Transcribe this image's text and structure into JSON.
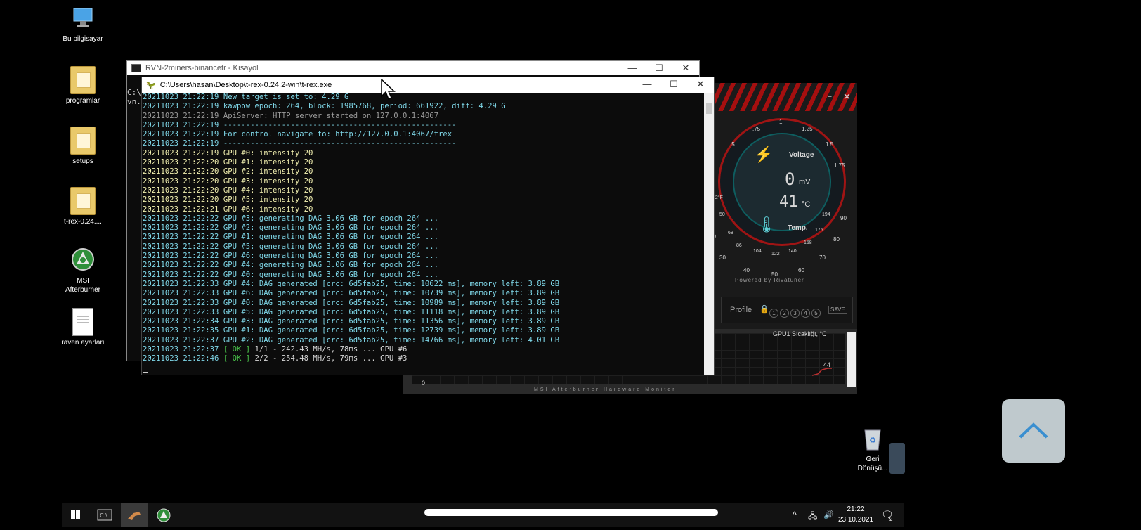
{
  "desktop": {
    "icons": [
      {
        "label": "Bu bilgisayar",
        "icon": "computer-icon"
      },
      {
        "label": "programlar",
        "icon": "folder-icon"
      },
      {
        "label": "setups",
        "icon": "folder-icon"
      },
      {
        "label": "t-rex-0.24....",
        "icon": "folder-icon"
      },
      {
        "label": "MSI Afterburner",
        "icon": "afterburner-icon"
      },
      {
        "label": "raven ayarları",
        "icon": "document-icon"
      }
    ],
    "recycle_bin": "Geri Dönüşü..."
  },
  "back_window": {
    "title": "RVN-2miners-binancetr - Kısayol",
    "visible_text": [
      "C:\\",
      "vn."
    ]
  },
  "terminal": {
    "title": "C:\\Users\\hasan\\Desktop\\t-rex-0.24.2-win\\t-rex.exe",
    "lines": [
      {
        "ts": "20211023 21:22:19",
        "msg": "New target is set to: 4.29 G",
        "color": "cyan"
      },
      {
        "ts": "20211023 21:22:19",
        "msg": "kawpow epoch: 264, block: 1985768, period: 661922, diff: 4.29 G",
        "color": "cyan"
      },
      {
        "ts": "20211023 21:22:19",
        "msg": "ApiServer: HTTP server started on 127.0.0.1:4067",
        "color": "gray"
      },
      {
        "ts": "20211023 21:22:19",
        "msg": "----------------------------------------------------",
        "color": "cyan"
      },
      {
        "ts": "20211023 21:22:19",
        "msg": "For control navigate to: http://127.0.0.1:4067/trex",
        "color": "cyan"
      },
      {
        "ts": "20211023 21:22:19",
        "msg": "----------------------------------------------------",
        "color": "cyan"
      },
      {
        "ts": "20211023 21:22:19",
        "msg": "GPU #0: intensity 20",
        "color": "yellow"
      },
      {
        "ts": "20211023 21:22:20",
        "msg": "GPU #1: intensity 20",
        "color": "yellow"
      },
      {
        "ts": "20211023 21:22:20",
        "msg": "GPU #2: intensity 20",
        "color": "yellow"
      },
      {
        "ts": "20211023 21:22:20",
        "msg": "GPU #3: intensity 20",
        "color": "yellow"
      },
      {
        "ts": "20211023 21:22:20",
        "msg": "GPU #4: intensity 20",
        "color": "yellow"
      },
      {
        "ts": "20211023 21:22:20",
        "msg": "GPU #5: intensity 20",
        "color": "yellow"
      },
      {
        "ts": "20211023 21:22:21",
        "msg": "GPU #6: intensity 20",
        "color": "yellow"
      },
      {
        "ts": "20211023 21:22:22",
        "msg": "GPU #3: generating DAG 3.06 GB for epoch 264 ...",
        "color": "cyan"
      },
      {
        "ts": "20211023 21:22:22",
        "msg": "GPU #2: generating DAG 3.06 GB for epoch 264 ...",
        "color": "cyan"
      },
      {
        "ts": "20211023 21:22:22",
        "msg": "GPU #1: generating DAG 3.06 GB for epoch 264 ...",
        "color": "cyan"
      },
      {
        "ts": "20211023 21:22:22",
        "msg": "GPU #5: generating DAG 3.06 GB for epoch 264 ...",
        "color": "cyan"
      },
      {
        "ts": "20211023 21:22:22",
        "msg": "GPU #6: generating DAG 3.06 GB for epoch 264 ...",
        "color": "cyan"
      },
      {
        "ts": "20211023 21:22:22",
        "msg": "GPU #4: generating DAG 3.06 GB for epoch 264 ...",
        "color": "cyan"
      },
      {
        "ts": "20211023 21:22:22",
        "msg": "GPU #0: generating DAG 3.06 GB for epoch 264 ...",
        "color": "cyan"
      },
      {
        "ts": "20211023 21:22:33",
        "msg": "GPU #4: DAG generated [crc: 6d5fab25, time: 10622 ms], memory left: 3.89 GB",
        "color": "cyan"
      },
      {
        "ts": "20211023 21:22:33",
        "msg": "GPU #6: DAG generated [crc: 6d5fab25, time: 10739 ms], memory left: 3.89 GB",
        "color": "cyan"
      },
      {
        "ts": "20211023 21:22:33",
        "msg": "GPU #0: DAG generated [crc: 6d5fab25, time: 10989 ms], memory left: 3.89 GB",
        "color": "cyan"
      },
      {
        "ts": "20211023 21:22:33",
        "msg": "GPU #5: DAG generated [crc: 6d5fab25, time: 11118 ms], memory left: 3.89 GB",
        "color": "cyan"
      },
      {
        "ts": "20211023 21:22:34",
        "msg": "GPU #3: DAG generated [crc: 6d5fab25, time: 11356 ms], memory left: 3.89 GB",
        "color": "cyan"
      },
      {
        "ts": "20211023 21:22:35",
        "msg": "GPU #1: DAG generated [crc: 6d5fab25, time: 12739 ms], memory left: 3.89 GB",
        "color": "cyan"
      },
      {
        "ts": "20211023 21:22:37",
        "msg": "GPU #2: DAG generated [crc: 6d5fab25, time: 14766 ms], memory left: 4.01 GB",
        "color": "cyan"
      }
    ],
    "share_lines": [
      {
        "ts": "20211023 21:22:37",
        "ok": "[ OK ]",
        "msg": "1/1 - 242.43 MH/s, 78ms ... GPU #6"
      },
      {
        "ts": "20211023 21:22:46",
        "ok": "[ OK ]",
        "msg": "2/2 - 254.48 MH/s, 79ms ... GPU #3"
      }
    ]
  },
  "afterburner": {
    "voltage_label": "Voltage",
    "voltage_value": "0",
    "voltage_unit": "mV",
    "temp_value": "41",
    "temp_unit": "°C",
    "temp_label": "Temp.",
    "powered_by": "Powered by Rivatuner",
    "profile_label": "Profile",
    "profile_slots": [
      "1",
      "2",
      "3",
      "4",
      "5"
    ],
    "save_label": "SAVE",
    "voltage_ticks": [
      ".75",
      "1",
      "1.25",
      ".5",
      "1.5",
      "1.75"
    ],
    "temp_ticks": [
      "32°F",
      "50",
      "68",
      "86",
      "104",
      "122",
      "140",
      "158",
      "176",
      "194"
    ],
    "temp_c_ticks": [
      "20",
      "30",
      "40",
      "50",
      "60",
      "70",
      "80",
      "90"
    ],
    "monitor_title": "GPU1 Sıcaklığı, °C",
    "monitor_value": "44",
    "monitor_min": "0",
    "monitor_footer": "MSI Afterburner Hardware Monitor"
  },
  "taskbar": {
    "time": "21:22",
    "date": "23.10.2021",
    "notification_count": "2"
  }
}
